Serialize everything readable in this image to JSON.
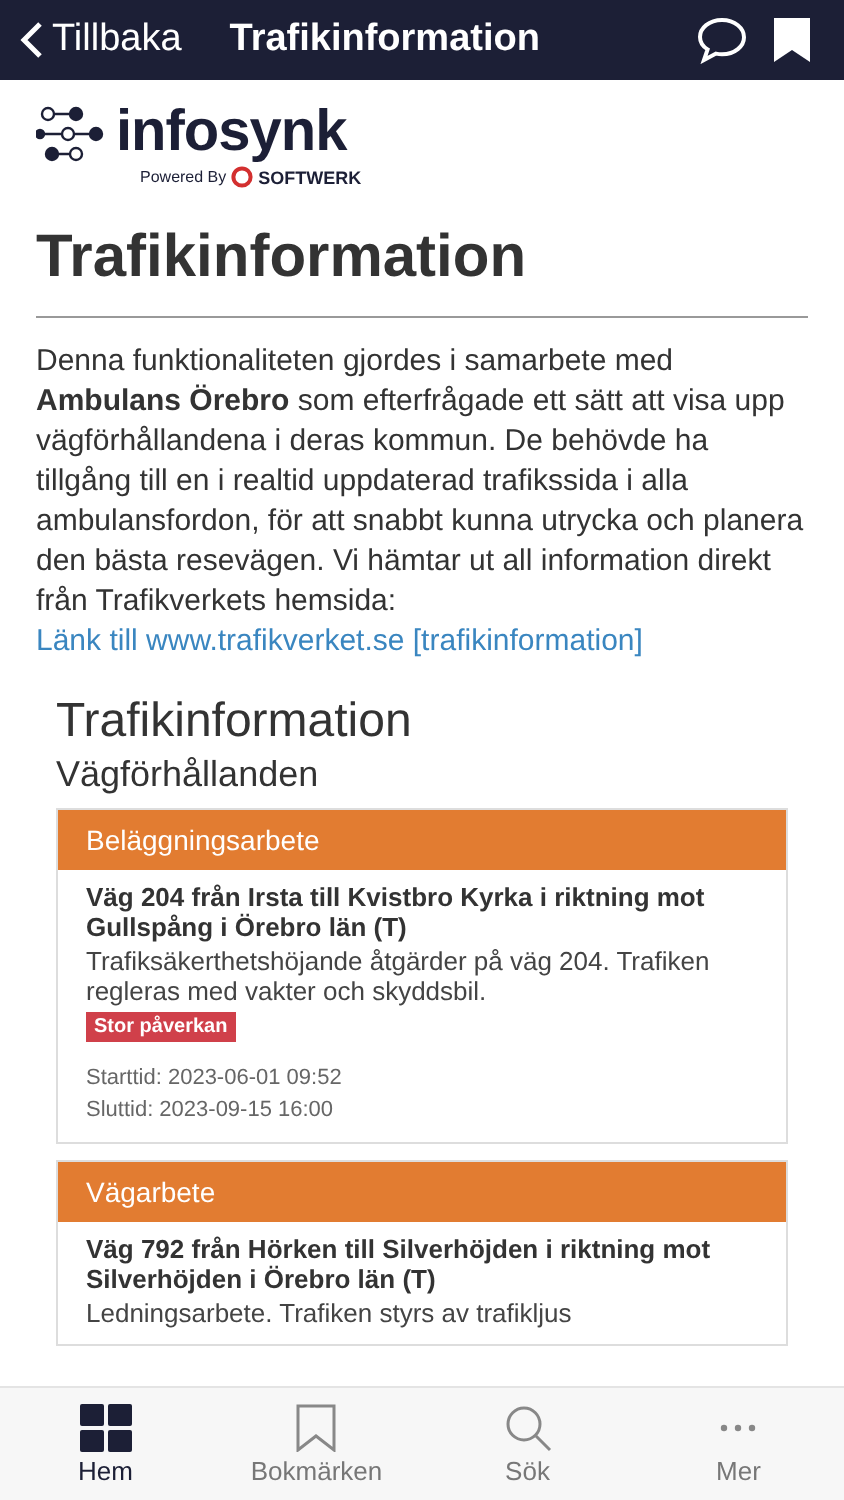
{
  "nav": {
    "back": "Tillbaka",
    "title": "Trafikinformation"
  },
  "logo": {
    "name": "infosynk",
    "powered": "Powered By",
    "brand": "SOFTWERK"
  },
  "page_title": "Trafikinformation",
  "intro": {
    "before": "Denna funktionaliteten gjordes i samarbete med ",
    "bold": "Ambulans Örebro",
    "after": " som efterfrågade ett sätt att visa upp vägförhållandena i deras kommun. De behövde ha tillgång till en i realtid uppdaterad trafikssida i alla ambulansfordon, för att snabbt kunna utrycka och planera den bästa resevägen. Vi hämtar ut all information direkt från Trafikverkets hemsida: ",
    "link": "Länk till www.trafikverket.se [trafikinformation]"
  },
  "section": {
    "title": "Trafikinformation",
    "subtitle": "Vägförhållanden"
  },
  "incidents": [
    {
      "category": "Beläggningsarbete",
      "title": "Väg 204 från Irsta till Kvistbro Kyrka i riktning mot Gullspång i Örebro län (T)",
      "description": "Trafiksäkerthetshöjande åtgärder på väg 204. Trafiken regleras med vakter och skyddsbil.",
      "impact": "Stor påverkan",
      "start": "Starttid: 2023-06-01 09:52",
      "end": "Sluttid: 2023-09-15 16:00"
    },
    {
      "category": "Vägarbete",
      "title": "Väg 792 från Hörken till Silverhöjden i riktning mot Silverhöjden i Örebro län (T)",
      "description": "Ledningsarbete. Trafiken styrs av trafikljus"
    }
  ],
  "tabs": [
    {
      "label": "Hem",
      "selected": true
    },
    {
      "label": "Bokmärken",
      "selected": false
    },
    {
      "label": "Sök",
      "selected": false
    },
    {
      "label": "Mer",
      "selected": false
    }
  ]
}
